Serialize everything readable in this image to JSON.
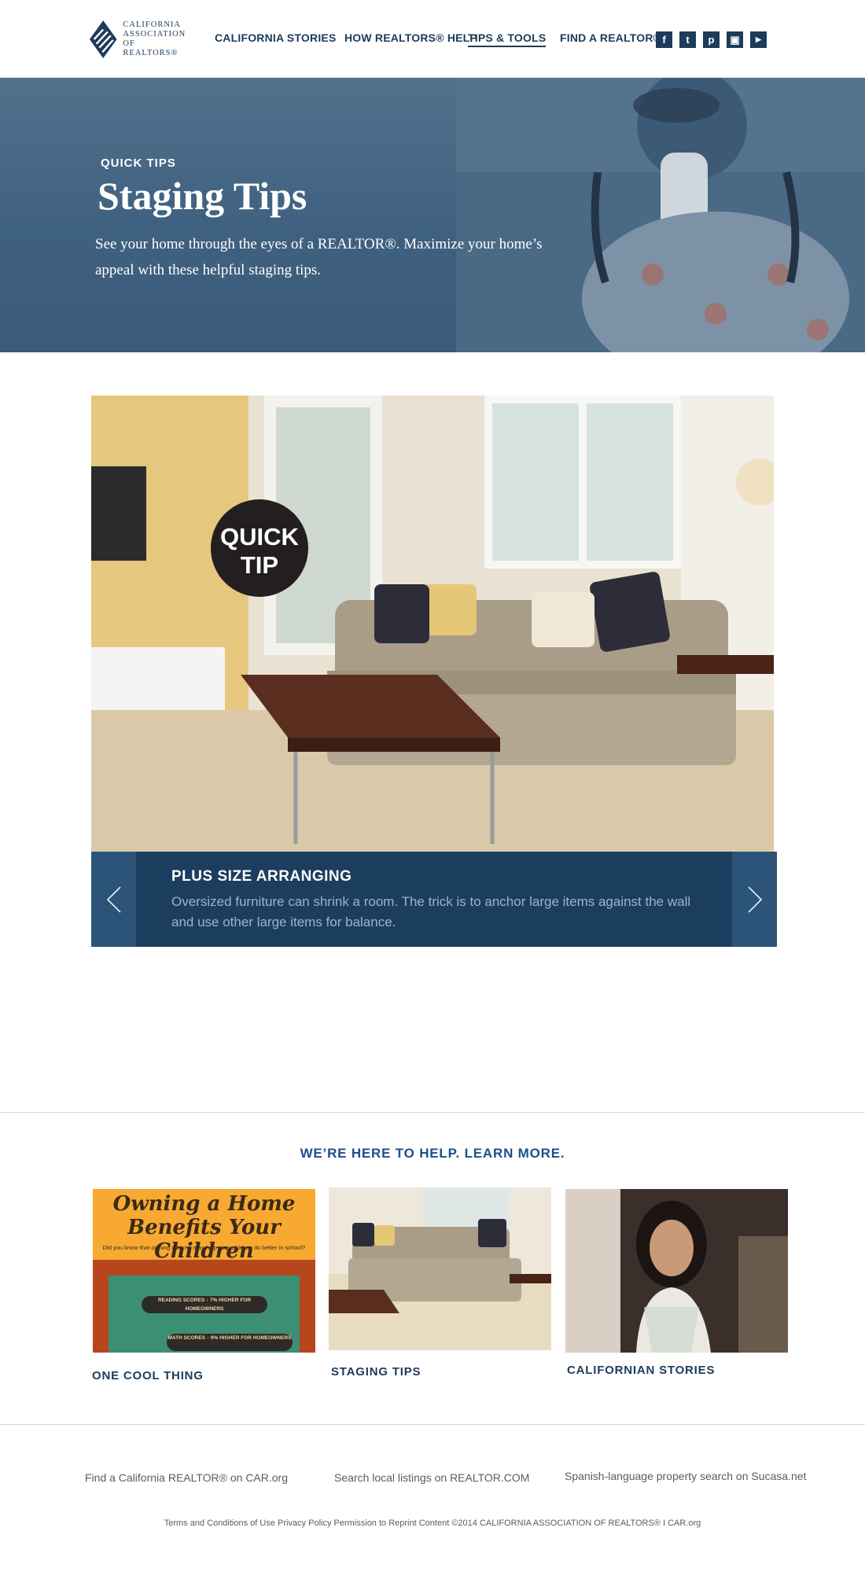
{
  "header": {
    "logo_text": "CALIFORNIA\nASSOCIATION\nOF REALTORS®",
    "nav": [
      {
        "label": "CALIFORNIA STORIES"
      },
      {
        "label": "HOW REALTORS® HELP"
      },
      {
        "label": "TIPS & TOOLS"
      },
      {
        "label": "FIND A REALTOR®"
      }
    ],
    "social": [
      {
        "icon": "facebook-icon",
        "glyph": "f"
      },
      {
        "icon": "twitter-icon",
        "glyph": "t"
      },
      {
        "icon": "pinterest-icon",
        "glyph": "p"
      },
      {
        "icon": "instagram-icon",
        "glyph": "▣"
      },
      {
        "icon": "youtube-icon",
        "glyph": "▶"
      }
    ]
  },
  "hero": {
    "label": "QUICK TIPS",
    "title": "Staging Tips",
    "description": "See your home through the eyes of a REALTOR®. Maximize your home’s appeal with these helpful staging tips."
  },
  "slide": {
    "badge": "QUICK TIP",
    "title": "PLUS SIZE ARRANGING",
    "text": "Oversized furniture can shrink a room. The trick is to anchor large items against the wall and use other large items for balance."
  },
  "learn_more": {
    "heading": "WE’RE HERE TO HELP. LEARN MORE.",
    "cards": [
      {
        "label": "ONE COOL THING",
        "poster_title": "Owning a Home Benefits Your Children",
        "poster_subtitle": "Did you know that owning a home may help your children do better in school?",
        "poster_line1": "READING SCORES ↑ 7% HIGHER FOR HOMEOWNERS",
        "poster_line2": "MATH SCORES ↑ 9% HIGHER FOR HOMEOWNERS"
      },
      {
        "label": "STAGING TIPS"
      },
      {
        "label": "CALIFORNIAN STORIES"
      }
    ]
  },
  "footer": {
    "links": [
      "Find a California REALTOR® on CAR.org",
      "Search local listings on REALTOR.COM",
      "Spanish-language property search on Sucasa.net"
    ],
    "legal": "Terms and Conditions of Use Privacy Policy Permission to Reprint Content ©2014 CALIFORNIA ASSOCIATION OF REALTORS® I CAR.org"
  },
  "colors": {
    "navy": "#1d3b5a",
    "caption_bg": "#1c3e5e",
    "heading_blue": "#1d4f8c",
    "poster_orange": "#f7a932"
  }
}
